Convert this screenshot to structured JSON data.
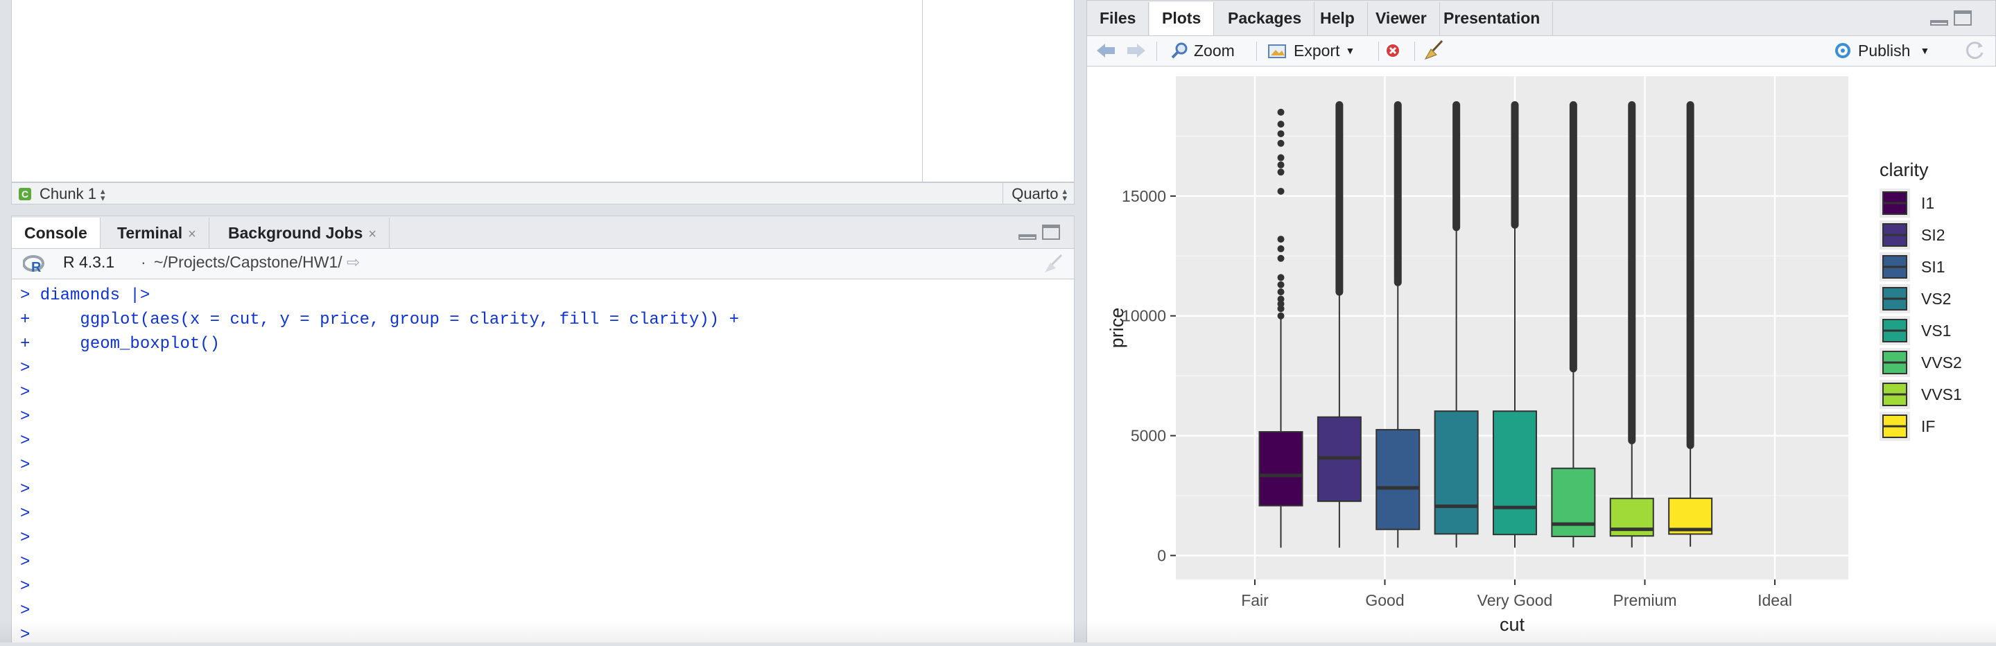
{
  "editor": {
    "chunk_label": "Chunk 1",
    "chunk_icon": "chunk-icon",
    "doc_type": "Quarto"
  },
  "console_pane": {
    "tabs": [
      {
        "label": "Console",
        "active": true,
        "closable": false
      },
      {
        "label": "Terminal",
        "active": false,
        "closable": true
      },
      {
        "label": "Background Jobs",
        "active": false,
        "closable": true
      }
    ],
    "r_version": "R 4.3.1",
    "separator": "·",
    "path": "~/Projects/Capstone/HW1/",
    "lines": [
      "> diamonds |>",
      "+     ggplot(aes(x = cut, y = price, group = clarity, fill = clarity)) +",
      "+     geom_boxplot()",
      ">",
      ">",
      ">",
      ">",
      ">",
      ">",
      ">",
      ">",
      ">",
      ">",
      ">",
      ">"
    ]
  },
  "right_pane": {
    "tabs": [
      {
        "label": "Files",
        "active": false
      },
      {
        "label": "Plots",
        "active": true
      },
      {
        "label": "Packages",
        "active": false
      },
      {
        "label": "Help",
        "active": false
      },
      {
        "label": "Viewer",
        "active": false
      },
      {
        "label": "Presentation",
        "active": false
      }
    ],
    "toolbar": {
      "zoom_label": "Zoom",
      "export_label": "Export",
      "publish_label": "Publish"
    }
  },
  "chart_data": {
    "type": "boxplot",
    "title": "",
    "xlabel": "cut",
    "ylabel": "price",
    "x_categories": [
      "Fair",
      "Good",
      "Very Good",
      "Premium",
      "Ideal"
    ],
    "y_ticks": [
      0,
      5000,
      10000,
      15000
    ],
    "ylim": [
      -1000,
      20000
    ],
    "legend": {
      "title": "clarity",
      "position": "right"
    },
    "background": "#ebebeb",
    "grid": true,
    "series": [
      {
        "name": "I1",
        "color": "#440154",
        "x_pos": 1.2,
        "min": 326,
        "q1": 2079,
        "median": 3344,
        "q3": 5161,
        "whisker_max": 9900,
        "outliers": [
          10000,
          10300,
          10500,
          10700,
          11000,
          11300,
          11600,
          12400,
          12800,
          13200,
          15200,
          16000,
          16300,
          16600,
          17200,
          17600,
          18000,
          18500
        ]
      },
      {
        "name": "SI2",
        "color": "#46337e",
        "x_pos": 1.65,
        "min": 326,
        "q1": 2264,
        "median": 4072,
        "q3": 5777,
        "whisker_max": 11000,
        "outlier_range": [
          11000,
          18800
        ]
      },
      {
        "name": "SI1",
        "color": "#365c8d",
        "x_pos": 2.1,
        "min": 326,
        "q1": 1089,
        "median": 2822,
        "q3": 5250,
        "whisker_max": 11400,
        "outlier_range": [
          11400,
          18800
        ]
      },
      {
        "name": "VS2",
        "color": "#277f8e",
        "x_pos": 2.55,
        "min": 334,
        "q1": 900,
        "median": 2054,
        "q3": 6024,
        "whisker_max": 13700,
        "outlier_range": [
          13700,
          18800
        ]
      },
      {
        "name": "VS1",
        "color": "#1fa187",
        "x_pos": 3.0,
        "min": 327,
        "q1": 876,
        "median": 2005,
        "q3": 6023,
        "whisker_max": 13800,
        "outlier_range": [
          13800,
          18800
        ]
      },
      {
        "name": "VVS2",
        "color": "#4ac16d",
        "x_pos": 3.45,
        "min": 336,
        "q1": 794,
        "median": 1311,
        "q3": 3638,
        "whisker_max": 7800,
        "outlier_range": [
          7800,
          18800
        ]
      },
      {
        "name": "VVS1",
        "color": "#a0da39",
        "x_pos": 3.9,
        "min": 336,
        "q1": 816,
        "median": 1093,
        "q3": 2379,
        "whisker_max": 4800,
        "outlier_range": [
          4800,
          18800
        ]
      },
      {
        "name": "IF",
        "color": "#fde725",
        "x_pos": 4.35,
        "min": 369,
        "q1": 895,
        "median": 1081,
        "q3": 2388,
        "whisker_max": 4600,
        "outlier_range": [
          4600,
          18800
        ]
      }
    ]
  }
}
